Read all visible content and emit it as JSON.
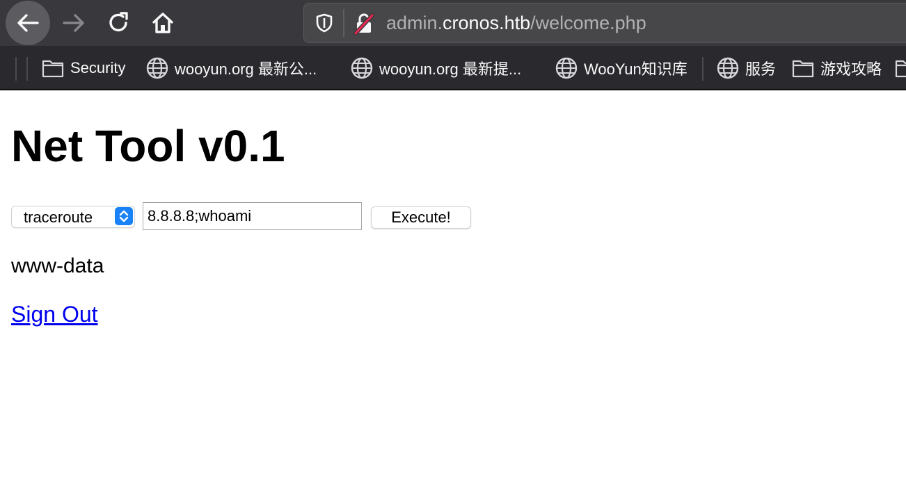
{
  "browser": {
    "url": {
      "prefix": "admin.",
      "host": "cronos.htb",
      "path": "/welcome.php"
    },
    "bookmarks": [
      {
        "label": "Security",
        "icon": "folder-icon"
      },
      {
        "label": "wooyun.org 最新公...",
        "icon": "globe-icon"
      },
      {
        "label": "wooyun.org 最新提...",
        "icon": "globe-icon"
      },
      {
        "label": "WooYun知识库",
        "icon": "globe-icon"
      },
      {
        "label": "服务",
        "icon": "globe-icon"
      },
      {
        "label": "游戏攻略",
        "icon": "folder-icon"
      }
    ]
  },
  "page": {
    "title": "Net Tool v0.1",
    "command_select": {
      "selected": "traceroute"
    },
    "host_input": {
      "value": "8.8.8.8;whoami"
    },
    "execute_label": "Execute!",
    "output": "www-data",
    "signout_label": "Sign Out"
  },
  "colors": {
    "toolbar": "#38383d",
    "bookmarks_bar": "#2a2a2e",
    "link": "#0000ee",
    "select_accent": "#1a82f7"
  }
}
